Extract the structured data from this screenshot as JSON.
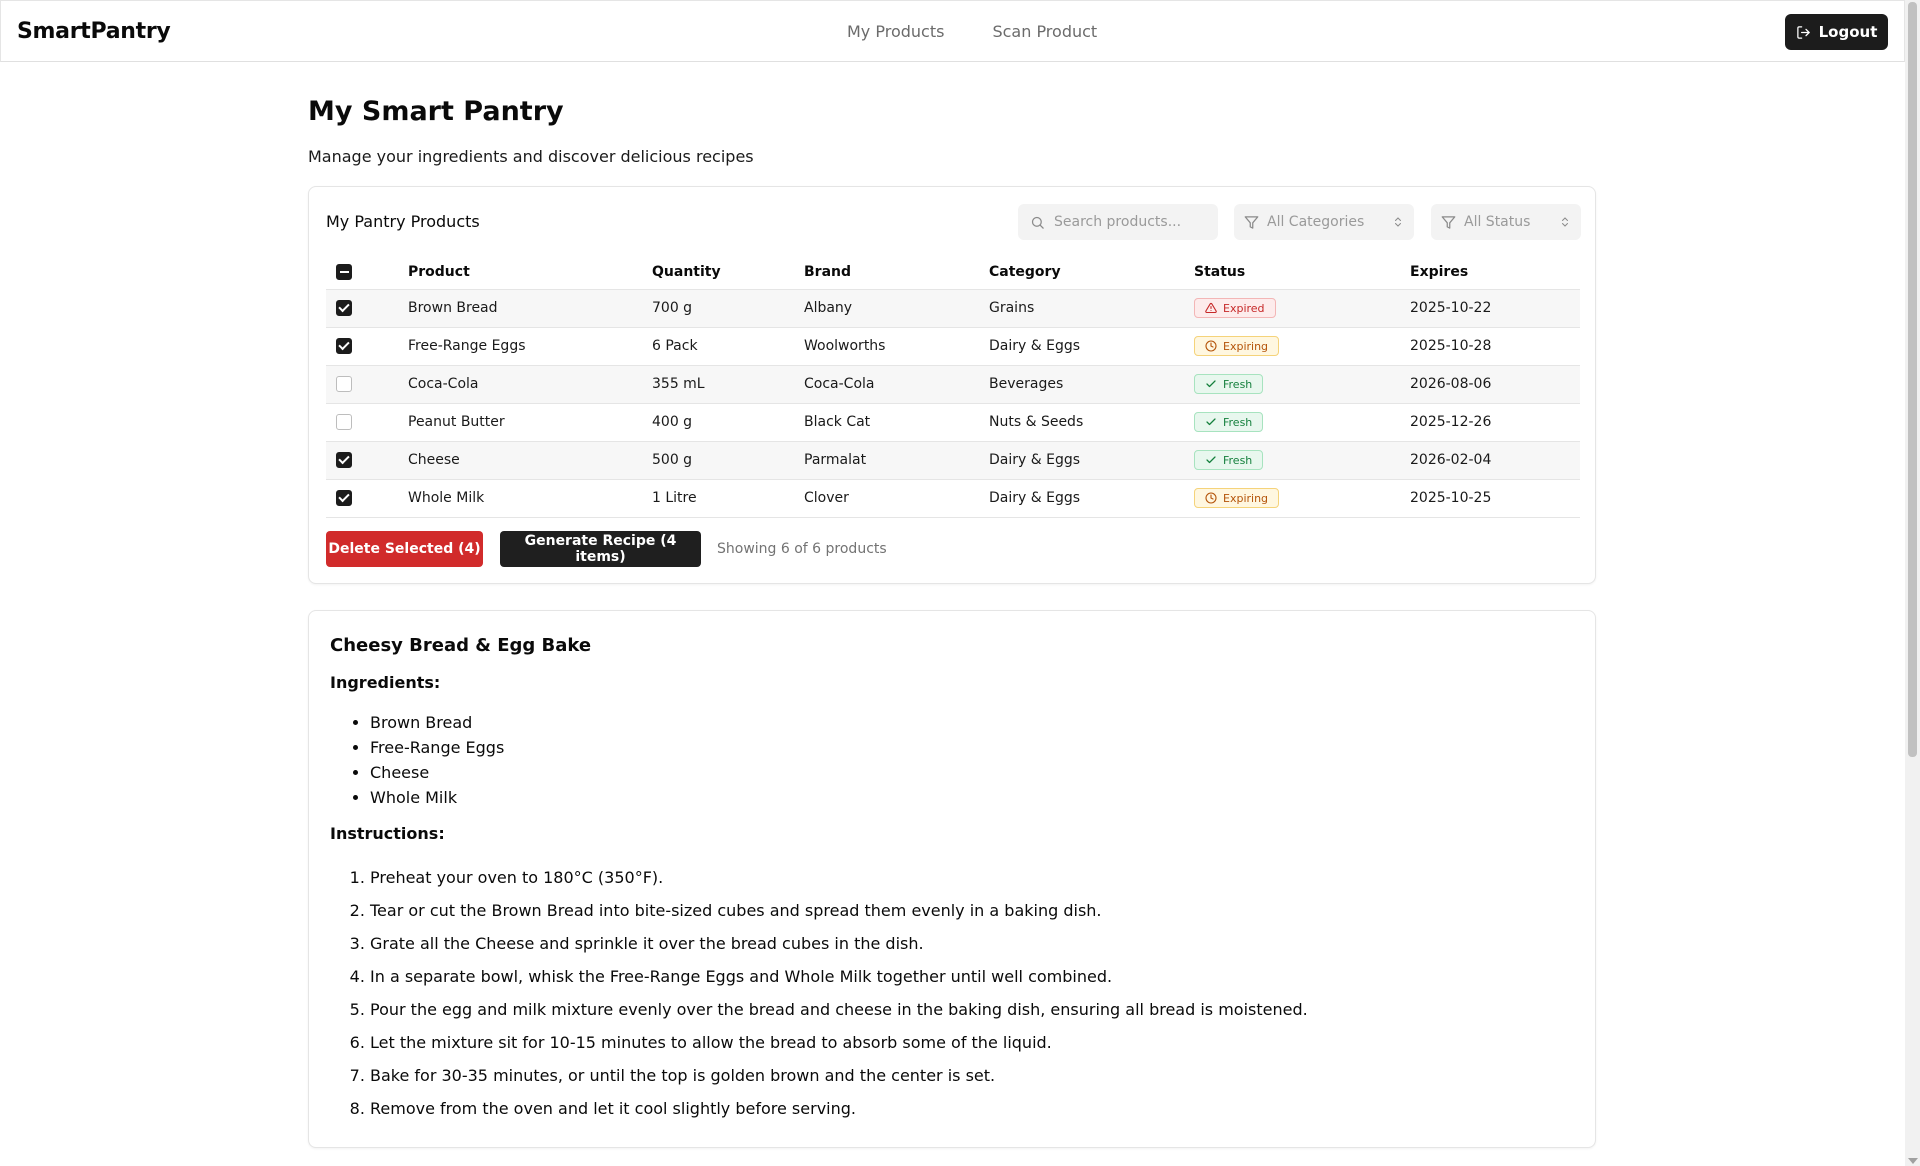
{
  "nav": {
    "brand": "SmartPantry",
    "links": [
      "My Products",
      "Scan Product"
    ],
    "logout_label": "Logout"
  },
  "page": {
    "title": "My Smart Pantry",
    "subtitle": "Manage your ingredients and discover delicious recipes"
  },
  "products": {
    "card_title": "My Pantry Products",
    "search_placeholder": "Search products...",
    "category_filter": "All Categories",
    "status_filter": "All Status",
    "columns": [
      "Product",
      "Quantity",
      "Brand",
      "Category",
      "Status",
      "Expires"
    ],
    "rows": [
      {
        "checked": true,
        "product": "Brown Bread",
        "quantity": "700 g",
        "brand": "Albany",
        "category": "Grains",
        "status": "Expired",
        "status_type": "expired",
        "expires": "2025-10-22"
      },
      {
        "checked": true,
        "product": "Free-Range Eggs",
        "quantity": "6 Pack",
        "brand": "Woolworths",
        "category": "Dairy & Eggs",
        "status": "Expiring",
        "status_type": "expiring",
        "expires": "2025-10-28"
      },
      {
        "checked": false,
        "product": "Coca-Cola",
        "quantity": "355 mL",
        "brand": "Coca-Cola",
        "category": "Beverages",
        "status": "Fresh",
        "status_type": "fresh",
        "expires": "2026-08-06"
      },
      {
        "checked": false,
        "product": "Peanut Butter",
        "quantity": "400 g",
        "brand": "Black Cat",
        "category": "Nuts & Seeds",
        "status": "Fresh",
        "status_type": "fresh",
        "expires": "2025-12-26"
      },
      {
        "checked": true,
        "product": "Cheese",
        "quantity": "500 g",
        "brand": "Parmalat",
        "category": "Dairy & Eggs",
        "status": "Fresh",
        "status_type": "fresh",
        "expires": "2026-02-04"
      },
      {
        "checked": true,
        "product": "Whole Milk",
        "quantity": "1 Litre",
        "brand": "Clover",
        "category": "Dairy & Eggs",
        "status": "Expiring",
        "status_type": "expiring",
        "expires": "2025-10-25"
      }
    ],
    "delete_label": "Delete Selected (4)",
    "generate_label": "Generate Recipe (4 items)",
    "showing_text": "Showing 6 of 6 products"
  },
  "recipe": {
    "title": "Cheesy Bread & Egg Bake",
    "ingredients_label": "Ingredients:",
    "ingredients": [
      "Brown Bread",
      "Free-Range Eggs",
      "Cheese",
      "Whole Milk"
    ],
    "instructions_label": "Instructions:",
    "instructions": [
      "Preheat your oven to 180°C (350°F).",
      "Tear or cut the Brown Bread into bite-sized cubes and spread them evenly in a baking dish.",
      "Grate all the Cheese and sprinkle it over the bread cubes in the dish.",
      "In a separate bowl, whisk the Free-Range Eggs and Whole Milk together until well combined.",
      "Pour the egg and milk mixture evenly over the bread and cheese in the baking dish, ensuring all bread is moistened.",
      "Let the mixture sit for 10-15 minutes to allow the bread to absorb some of the liquid.",
      "Bake for 30-35 minutes, or until the top is golden brown and the center is set.",
      "Remove from the oven and let it cool slightly before serving."
    ]
  },
  "icons": {
    "logout": "logout-icon",
    "search": "search-icon",
    "filter": "filter-icon",
    "chevron": "chevron-updown-icon",
    "expired": "alert-triangle-icon",
    "expiring": "clock-icon",
    "fresh": "check-icon"
  },
  "colors": {
    "danger": "#d12b2b",
    "primary": "#1f1f1f",
    "expired": "#c62828",
    "expiring": "#b45309",
    "fresh": "#15803d"
  }
}
